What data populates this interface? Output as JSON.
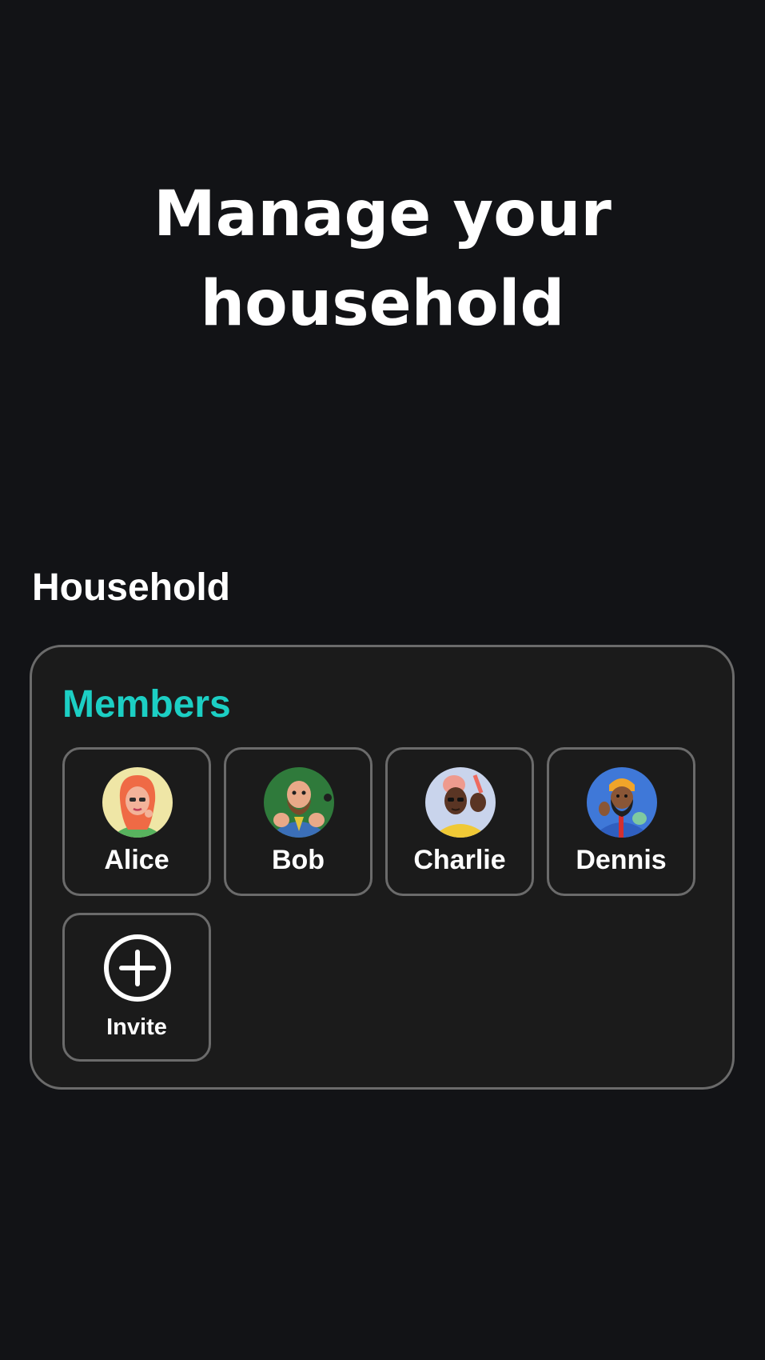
{
  "hero": {
    "title_line1": "Manage your",
    "title_line2": "household"
  },
  "section": {
    "heading": "Household"
  },
  "members_card": {
    "title": "Members",
    "accent_color": "#1ccfc4",
    "members": [
      {
        "name": "Alice",
        "icon": "alice-avatar"
      },
      {
        "name": "Bob",
        "icon": "bob-avatar"
      },
      {
        "name": "Charlie",
        "icon": "charlie-avatar"
      },
      {
        "name": "Dennis",
        "icon": "dennis-avatar"
      }
    ],
    "invite": {
      "label": "Invite",
      "icon": "plus-circle-icon"
    }
  }
}
